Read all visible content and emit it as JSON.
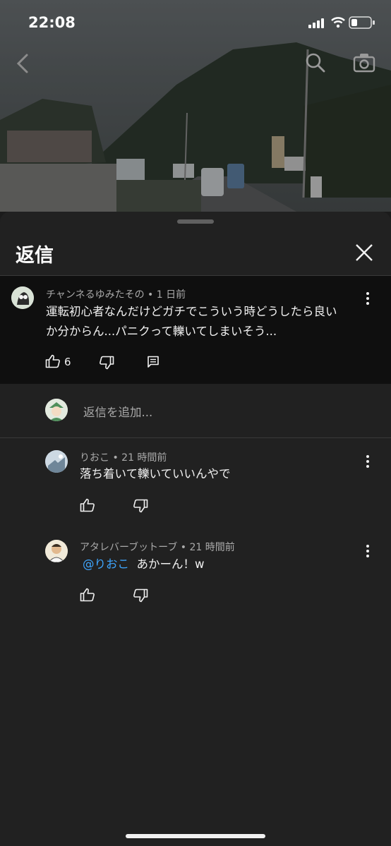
{
  "status": {
    "time": "22:08"
  },
  "sheet": {
    "title": "返信"
  },
  "parent_comment": {
    "author": "チャンネるゆみたその",
    "age": "1 日前",
    "meta_sep": " • ",
    "lines": [
      "運転初心者なんだけどガチでこういう時どうしたら良い",
      "か分からん...パニクって轢いてしまいそう..."
    ],
    "likes": "6"
  },
  "reply_input": {
    "placeholder": "返信を追加..."
  },
  "replies": [
    {
      "author": "りおこ",
      "age": "21 時間前",
      "text": "落ち着いて轢いていいんやで"
    },
    {
      "author": "アタレバーブットーブ",
      "age": "21 時間前",
      "mention": "@りおこ",
      "text": "あかーん！w"
    }
  ],
  "colors": {
    "sheet_bg": "#212121",
    "parent_bg": "#0f0f0f",
    "mention": "#3ea6ff",
    "muted": "#aaaaaa"
  },
  "icons": [
    "back-icon",
    "search-icon",
    "camera-icon",
    "close-icon",
    "like-icon",
    "dislike-icon",
    "reply-icon",
    "more-icon"
  ]
}
